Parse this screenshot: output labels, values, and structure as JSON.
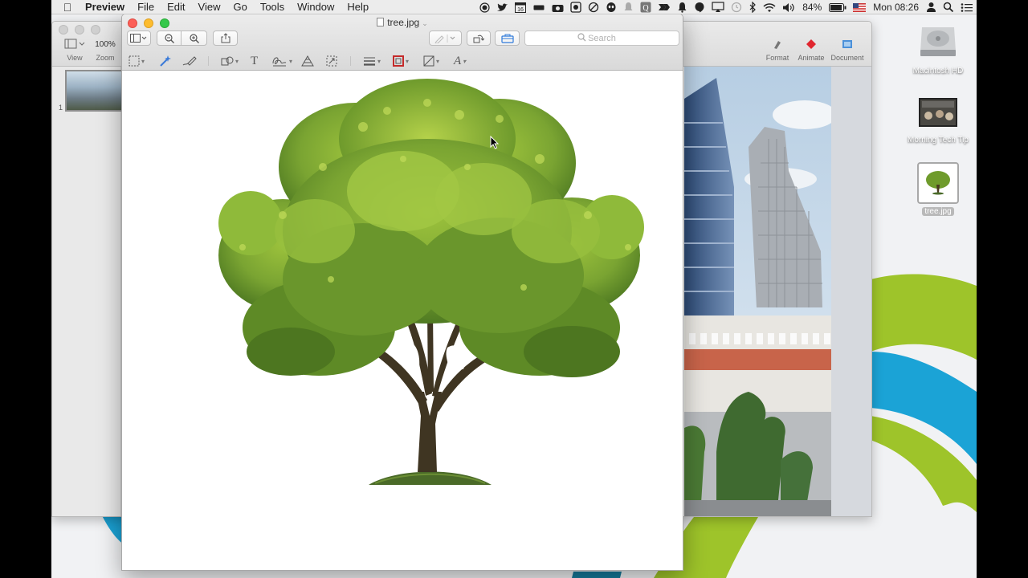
{
  "menubar": {
    "app_name": "Preview",
    "menus": [
      "File",
      "Edit",
      "View",
      "Go",
      "Tools",
      "Window",
      "Help"
    ],
    "calendar_day": "16",
    "battery": "84%",
    "clock": "Mon 08:26"
  },
  "background_window": {
    "toolbar_left": [
      {
        "label": "View",
        "value": ""
      },
      {
        "label": "Zoom",
        "value": "100%"
      }
    ],
    "toolbar_right": [
      "Format",
      "Animate",
      "Document"
    ],
    "slide_number": "1"
  },
  "preview": {
    "title": "tree.jpg",
    "search_placeholder": "Search",
    "toolbar": {
      "sidebar": "sidebar-icon",
      "zoom_out": "zoom-out-icon",
      "zoom_in": "zoom-in-icon",
      "share": "share-icon",
      "markup_pen": "pen-icon",
      "rotate": "rotate-icon",
      "markup_toolbox": "toolbox-icon"
    },
    "markup_tools": [
      "rect-select",
      "instant-alpha",
      "sketch",
      "shapes",
      "text",
      "sign",
      "adjust-color",
      "adjust-size",
      "line-style",
      "border-color",
      "fill-color",
      "text-style"
    ]
  },
  "desktop": {
    "icons": [
      {
        "label": "Macintosh HD"
      },
      {
        "label": "Morning Tech Tip"
      },
      {
        "label": "tree.jpg"
      }
    ]
  },
  "colors": {
    "wallpaper_green": "#9ec42a",
    "wallpaper_blue": "#1ba3d6",
    "wallpaper_teal": "#157b9c",
    "foliage": "#6f9b2c"
  }
}
